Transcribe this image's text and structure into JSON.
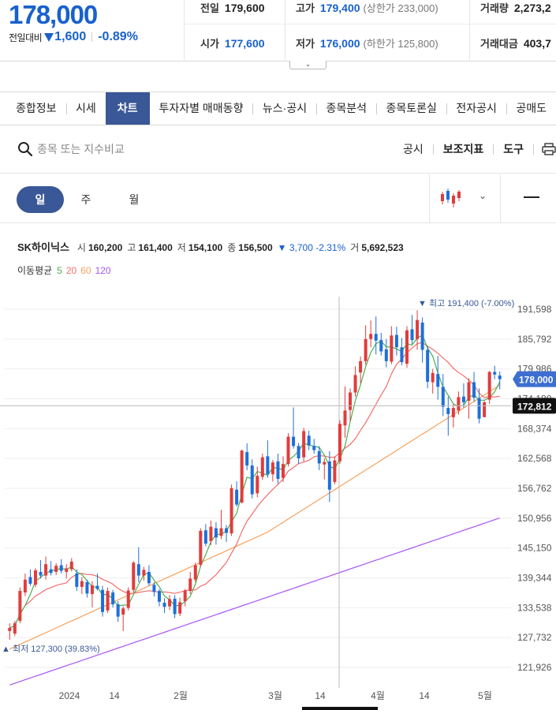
{
  "quote": {
    "price": "178,000",
    "change_label": "전일대비",
    "change_amount": "1,600",
    "change_pct": "-0.89%",
    "prev_label": "전일",
    "prev_value": "179,600",
    "high_label": "고가",
    "high_value": "179,400",
    "high_limit_label": "(상한가",
    "high_limit_value": "233,000)",
    "volume_label": "거래량",
    "volume_value": "2,273,2",
    "open_label": "시가",
    "open_value": "177,600",
    "low_label": "저가",
    "low_value": "176,000",
    "low_limit_label": "(하한가",
    "low_limit_value": "125,800)",
    "amount_label": "거래대금",
    "amount_value": "403,7",
    "expand_icon": "chevron-down-icon"
  },
  "tabs": [
    {
      "label": "종합정보",
      "active": false
    },
    {
      "label": "시세",
      "active": false
    },
    {
      "label": "차트",
      "active": true
    },
    {
      "label": "투자자별 매매동향",
      "active": false
    },
    {
      "label": "뉴스·공시",
      "active": false
    },
    {
      "label": "종목분석",
      "active": false
    },
    {
      "label": "종목토론실",
      "active": false
    },
    {
      "label": "전자공시",
      "active": false
    },
    {
      "label": "공매도",
      "active": false
    }
  ],
  "toolbar": {
    "search_placeholder": "종목 또는 지수비교",
    "links": [
      "공시",
      "보조지표",
      "도구"
    ]
  },
  "periods": [
    {
      "label": "일",
      "active": true
    },
    {
      "label": "주",
      "active": false
    },
    {
      "label": "월",
      "active": false
    }
  ],
  "chart_info": {
    "name": "SK하이닉스",
    "open_label": "시",
    "open": "160,200",
    "high_label": "고",
    "high": "161,400",
    "low_label": "저",
    "low": "154,100",
    "close_label": "종",
    "close": "156,500",
    "change": "▼ 3,700 -2.31%",
    "volume_label": "거",
    "volume": "5,692,523",
    "ma_label": "이동평균",
    "ma": [
      {
        "label": "5",
        "color": "#4caf50"
      },
      {
        "label": "20",
        "color": "#f26d6d"
      },
      {
        "label": "60",
        "color": "#f5a25d"
      },
      {
        "label": "120",
        "color": "#a855f7"
      }
    ]
  },
  "colors": {
    "up": "#e03c3c",
    "down": "#1e6fd9",
    "accent": "#3a5897",
    "price_blue": "#1861cc"
  },
  "chart_data": {
    "type": "candlestick",
    "y_ticks": [
      "191,598",
      "185,792",
      "179,986",
      "174,180",
      "168,374",
      "162,568",
      "156,762",
      "150,956",
      "145,150",
      "139,344",
      "133,538",
      "127,732",
      "121,926"
    ],
    "x_ticks": [
      "2024",
      "14",
      "2월",
      "3월",
      "14",
      "4월",
      "14",
      "5월"
    ],
    "ylim": [
      118000,
      196000
    ],
    "current_price": "178,000",
    "crosshair_price": "172,812",
    "max_annotation": "▼ 최고 191,400 (-7.00%)",
    "min_annotation": "▲ 최저 127,300 (39.83%)",
    "candles": [
      [
        129000,
        130500,
        127300,
        129600
      ],
      [
        128500,
        131000,
        128000,
        130500
      ],
      [
        131000,
        137500,
        130500,
        136800
      ],
      [
        136500,
        140200,
        135800,
        139000
      ],
      [
        139500,
        141000,
        137800,
        138200
      ],
      [
        138000,
        141200,
        137500,
        140800
      ],
      [
        140500,
        142800,
        139200,
        139800
      ],
      [
        139800,
        143500,
        139000,
        142000
      ],
      [
        141000,
        142600,
        139800,
        140300
      ],
      [
        140500,
        142200,
        139900,
        141700
      ],
      [
        141800,
        143000,
        140200,
        140700
      ],
      [
        140500,
        142000,
        139200,
        141200
      ],
      [
        141000,
        143200,
        140600,
        142500
      ],
      [
        140200,
        141000,
        136800,
        137600
      ],
      [
        137600,
        139500,
        136200,
        138700
      ],
      [
        138500,
        139000,
        135500,
        136300
      ],
      [
        136200,
        138700,
        133600,
        137900
      ],
      [
        137800,
        140200,
        136900,
        137200
      ],
      [
        137000,
        137800,
        131800,
        132700
      ],
      [
        133000,
        137500,
        132500,
        136800
      ],
      [
        136500,
        137000,
        133600,
        134200
      ],
      [
        134200,
        134800,
        130800,
        131800
      ],
      [
        132200,
        133800,
        129000,
        133400
      ],
      [
        133500,
        137500,
        133000,
        136900
      ],
      [
        137000,
        142600,
        136500,
        142300
      ],
      [
        142000,
        145300,
        138500,
        139800
      ],
      [
        139800,
        141500,
        138800,
        140900
      ],
      [
        140500,
        141800,
        137800,
        138300
      ],
      [
        138000,
        138500,
        135700,
        136600
      ],
      [
        136800,
        137200,
        133800,
        134700
      ],
      [
        134500,
        135400,
        132500,
        133700
      ],
      [
        133800,
        136000,
        133100,
        135200
      ],
      [
        135300,
        136000,
        131500,
        132300
      ],
      [
        132400,
        135500,
        131900,
        134600
      ],
      [
        134800,
        137200,
        133800,
        136900
      ],
      [
        136800,
        140500,
        136200,
        139200
      ],
      [
        139000,
        142300,
        138500,
        141800
      ],
      [
        141900,
        149000,
        141500,
        148500
      ],
      [
        148600,
        149800,
        145500,
        146000
      ],
      [
        146500,
        150500,
        145700,
        149300
      ],
      [
        149000,
        150200,
        145800,
        147200
      ],
      [
        147500,
        152600,
        146900,
        149000
      ],
      [
        149000,
        149600,
        146300,
        148100
      ],
      [
        148000,
        157500,
        147500,
        156800
      ],
      [
        156500,
        158100,
        153200,
        153600
      ],
      [
        154000,
        164300,
        153800,
        164100
      ],
      [
        163800,
        165500,
        160300,
        161200
      ],
      [
        161200,
        162400,
        154800,
        155600
      ],
      [
        155800,
        161000,
        155000,
        159200
      ],
      [
        159000,
        163500,
        158400,
        162800
      ],
      [
        163000,
        166100,
        158800,
        159500
      ],
      [
        159500,
        162300,
        158100,
        161800
      ],
      [
        162000,
        163500,
        157700,
        158600
      ],
      [
        158800,
        163000,
        158000,
        161500
      ],
      [
        161500,
        167500,
        161000,
        166800
      ],
      [
        166800,
        172500,
        164500,
        165000
      ],
      [
        165000,
        165600,
        161500,
        162600
      ],
      [
        162800,
        168500,
        162000,
        167900
      ],
      [
        167000,
        168000,
        164200,
        165100
      ],
      [
        165000,
        166400,
        163500,
        164200
      ],
      [
        164000,
        165000,
        160300,
        161600
      ],
      [
        161400,
        162600,
        158500,
        161900
      ],
      [
        162000,
        164000,
        154100,
        156500
      ],
      [
        158000,
        163000,
        157500,
        162200
      ],
      [
        162000,
        170000,
        161500,
        169300
      ],
      [
        169000,
        176600,
        166600,
        171900
      ],
      [
        172000,
        176200,
        169800,
        175400
      ],
      [
        175400,
        180500,
        174600,
        178800
      ],
      [
        179300,
        182400,
        177200,
        181500
      ],
      [
        181500,
        188500,
        180800,
        185800
      ],
      [
        185800,
        189400,
        184200,
        186800
      ],
      [
        186800,
        190200,
        182800,
        185500
      ],
      [
        185600,
        187000,
        182600,
        183400
      ],
      [
        183800,
        185800,
        180300,
        181500
      ],
      [
        181400,
        188300,
        180900,
        186500
      ],
      [
        186600,
        188200,
        182600,
        184200
      ],
      [
        184200,
        186000,
        180700,
        181300
      ],
      [
        181000,
        188300,
        180200,
        187500
      ],
      [
        187700,
        190500,
        184800,
        185600
      ],
      [
        185800,
        191400,
        183700,
        189500
      ],
      [
        189000,
        190000,
        181200,
        183700
      ],
      [
        183700,
        184500,
        176200,
        177500
      ],
      [
        177400,
        180000,
        175200,
        179200
      ],
      [
        179000,
        182500,
        174000,
        176500
      ],
      [
        176500,
        179000,
        170800,
        172600
      ],
      [
        172400,
        174600,
        167000,
        171200
      ],
      [
        170600,
        173200,
        168600,
        172400
      ],
      [
        171900,
        175600,
        171100,
        174500
      ],
      [
        174600,
        177200,
        172400,
        173500
      ],
      [
        173800,
        178200,
        170300,
        177400
      ],
      [
        177400,
        179400,
        173600,
        174400
      ],
      [
        174300,
        176200,
        169400,
        170300
      ],
      [
        170600,
        173800,
        171200,
        173500
      ],
      [
        174000,
        179600,
        173200,
        179400
      ],
      [
        179400,
        180600,
        178000,
        178900
      ],
      [
        178700,
        179500,
        176000,
        178000
      ]
    ]
  }
}
